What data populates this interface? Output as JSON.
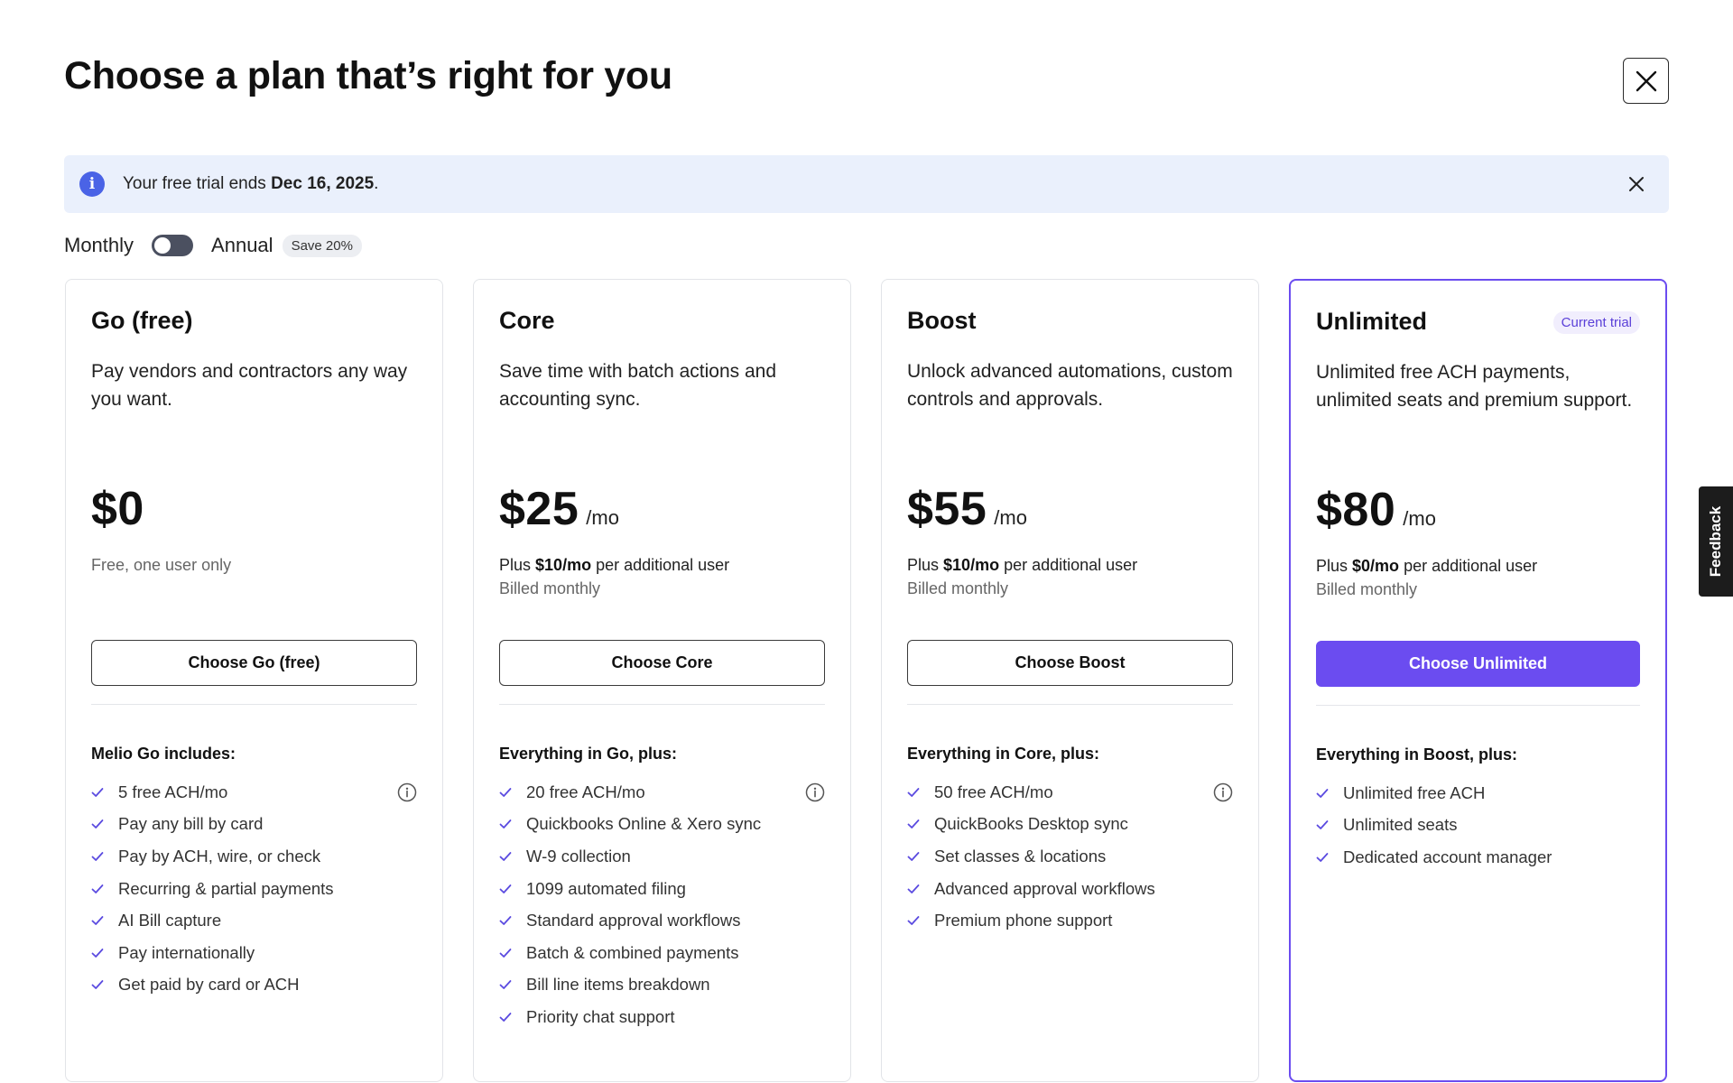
{
  "header": {
    "title": "Choose a plan that’s right for you"
  },
  "banner": {
    "text_prefix": "Your free trial ends ",
    "text_date": "Dec 16, 2025",
    "text_suffix": "."
  },
  "billing": {
    "monthly_label": "Monthly",
    "annual_label": "Annual",
    "save_badge": "Save 20%",
    "annual_selected": false
  },
  "plans": [
    {
      "name": "Go (free)",
      "description": "Pay vendors and contractors any way you want.",
      "price": "$0",
      "per": "",
      "subtext_prefix": "Free, one user only",
      "subtext_bold": "",
      "subtext_suffix": "",
      "billed": "",
      "button": "Choose Go (free)",
      "features_title": "Melio Go includes:",
      "features": [
        "5 free ACH/mo",
        "Pay any bill by card",
        "Pay by ACH, wire, or check",
        "Recurring & partial payments",
        "AI Bill capture",
        "Pay internationally",
        "Get paid by card or ACH"
      ]
    },
    {
      "name": "Core",
      "description": "Save time with batch actions and accounting sync.",
      "price": "$25",
      "per": "/mo",
      "subtext_prefix": "Plus ",
      "subtext_bold": "$10/mo",
      "subtext_suffix": " per additional user",
      "billed": "Billed monthly",
      "button": "Choose Core",
      "features_title": "Everything in Go, plus:",
      "features": [
        "20 free ACH/mo",
        "Quickbooks Online & Xero sync",
        "W-9 collection",
        "1099 automated filing",
        "Standard approval workflows",
        "Batch & combined payments",
        "Bill line items breakdown",
        "Priority chat support"
      ]
    },
    {
      "name": "Boost",
      "description": "Unlock advanced automations, custom controls and approvals.",
      "price": "$55",
      "per": "/mo",
      "subtext_prefix": "Plus ",
      "subtext_bold": "$10/mo",
      "subtext_suffix": " per additional user",
      "billed": "Billed monthly",
      "button": "Choose Boost",
      "features_title": "Everything in Core, plus:",
      "features": [
        "50 free ACH/mo",
        "QuickBooks Desktop sync",
        "Set classes & locations",
        "Advanced approval workflows",
        "Premium phone support"
      ]
    },
    {
      "name": "Unlimited",
      "badge": "Current trial",
      "description": "Unlimited free ACH payments, unlimited seats and premium support.",
      "price": "$80",
      "per": "/mo",
      "subtext_prefix": "Plus ",
      "subtext_bold": "$0/mo",
      "subtext_suffix": " per additional user",
      "billed": "Billed monthly",
      "button": "Choose Unlimited",
      "features_title": "Everything in Boost, plus:",
      "features": [
        "Unlimited free ACH",
        "Unlimited seats",
        "Dedicated account manager"
      ]
    }
  ],
  "feedback": {
    "label": "Feedback"
  },
  "colors": {
    "accent": "#6b4cf0",
    "info": "#4a63e6",
    "banner_bg": "#eaf0fc"
  },
  "icons": {
    "close": "close-icon",
    "info": "info-icon",
    "check": "check-icon"
  }
}
